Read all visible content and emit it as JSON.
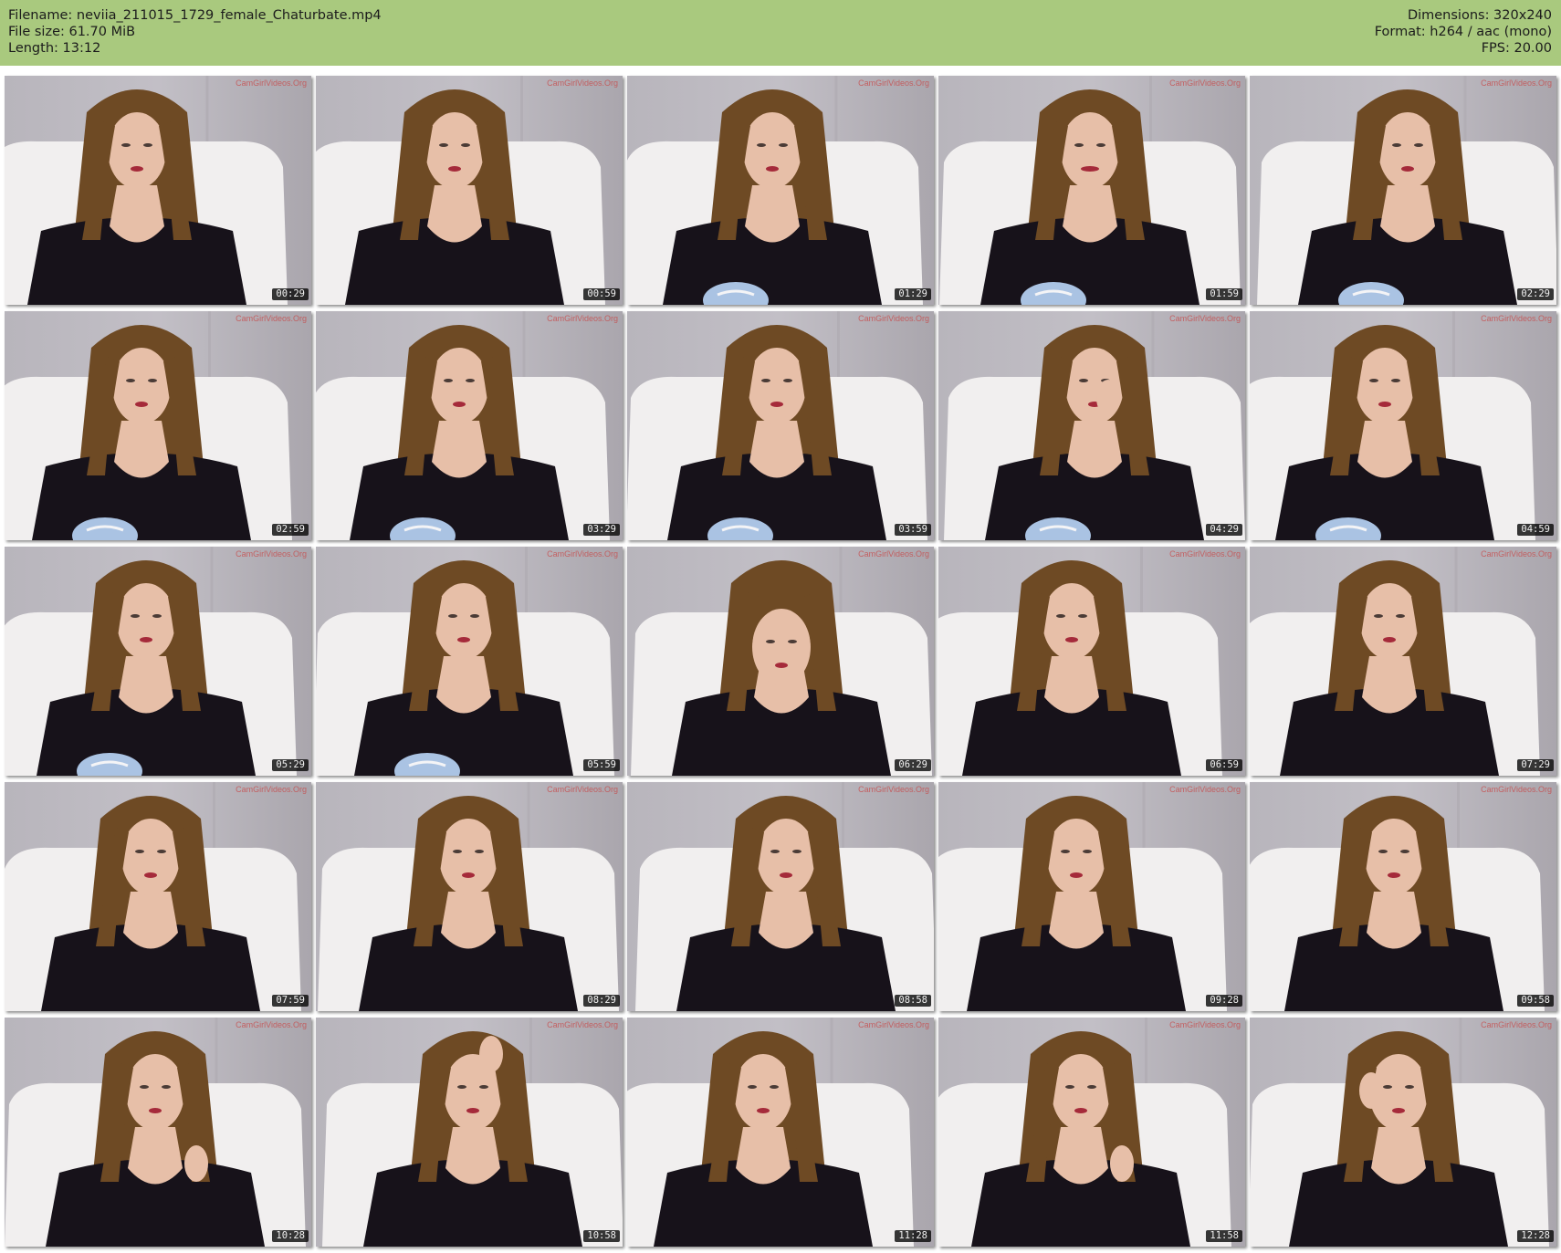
{
  "header": {
    "filename_label": "Filename: neviia_211015_1729_female_Chaturbate.mp4",
    "filesize_label": "File size: 61.70 MiB",
    "length_label": "Length: 13:12",
    "dimensions_label": "Dimensions: 320x240",
    "format_label": "Format: h264 / aac (mono)",
    "fps_label": "FPS: 20.00"
  },
  "watermark_text": "CamGirlVideos.Org",
  "colors": {
    "header_bg": "#a9c97e",
    "wall": "#c2bfc6",
    "hair": "#6e4a24",
    "top": "#17121a",
    "skin": "#e7bfa8",
    "jeans": "#aac3e3"
  },
  "thumbnails": [
    {
      "timestamp": "00:29",
      "variant": "jeans-none"
    },
    {
      "timestamp": "00:59",
      "variant": "jeans-none"
    },
    {
      "timestamp": "01:29",
      "variant": "jeans"
    },
    {
      "timestamp": "01:59",
      "variant": "jeans-smile"
    },
    {
      "timestamp": "02:29",
      "variant": "jeans"
    },
    {
      "timestamp": "02:59",
      "variant": "jeans"
    },
    {
      "timestamp": "03:29",
      "variant": "jeans"
    },
    {
      "timestamp": "03:59",
      "variant": "jeans"
    },
    {
      "timestamp": "04:29",
      "variant": "jeans-hand"
    },
    {
      "timestamp": "04:59",
      "variant": "jeans"
    },
    {
      "timestamp": "05:29",
      "variant": "jeans"
    },
    {
      "timestamp": "05:59",
      "variant": "jeans"
    },
    {
      "timestamp": "06:29",
      "variant": "tilt"
    },
    {
      "timestamp": "06:59",
      "variant": "plain"
    },
    {
      "timestamp": "07:29",
      "variant": "plain"
    },
    {
      "timestamp": "07:59",
      "variant": "plain"
    },
    {
      "timestamp": "08:29",
      "variant": "plain"
    },
    {
      "timestamp": "08:58",
      "variant": "plain"
    },
    {
      "timestamp": "09:28",
      "variant": "plain"
    },
    {
      "timestamp": "09:58",
      "variant": "plain"
    },
    {
      "timestamp": "10:28",
      "variant": "hand"
    },
    {
      "timestamp": "10:58",
      "variant": "hand-head"
    },
    {
      "timestamp": "11:28",
      "variant": "plain"
    },
    {
      "timestamp": "11:58",
      "variant": "hand"
    },
    {
      "timestamp": "12:28",
      "variant": "hand-face"
    }
  ]
}
